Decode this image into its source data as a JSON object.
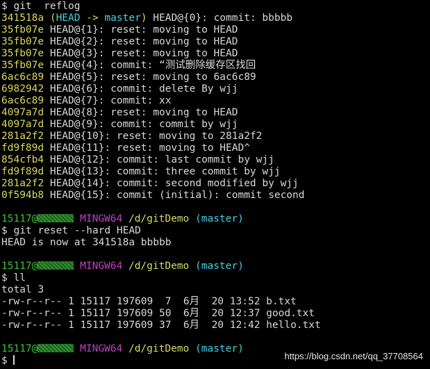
{
  "colors": {
    "background": "#000000",
    "text": "#d8d8d8",
    "hash": "#d8d860",
    "branch": "#48d0e0",
    "user": "#3cc33c",
    "mingw": "#c040c0",
    "path": "#d8d860"
  },
  "command1": "$ git  reflog",
  "reflog_first": {
    "hash": "341518a",
    "decoration_open": "(",
    "decoration_head": "HEAD",
    "decoration_arrow": " -> ",
    "decoration_branch": "master",
    "decoration_close": ")",
    "text": " HEAD@{0}: commit: bbbbb"
  },
  "reflog_entries": [
    {
      "hash": "35fb07e",
      "text": " HEAD@{1}: reset: moving to HEAD"
    },
    {
      "hash": "35fb07e",
      "text": " HEAD@{2}: reset: moving to HEAD"
    },
    {
      "hash": "35fb07e",
      "text": " HEAD@{3}: reset: moving to HEAD"
    },
    {
      "hash": "35fb07e",
      "text": " HEAD@{4}: commit: “测试删除缓存区找回"
    },
    {
      "hash": "6ac6c89",
      "text": " HEAD@{5}: reset: moving to 6ac6c89"
    },
    {
      "hash": "6982942",
      "text": " HEAD@{6}: commit: delete By wjj"
    },
    {
      "hash": "6ac6c89",
      "text": " HEAD@{7}: commit: xx"
    },
    {
      "hash": "4097a7d",
      "text": " HEAD@{8}: reset: moving to HEAD"
    },
    {
      "hash": "4097a7d",
      "text": " HEAD@{9}: commit: commit by wjj"
    },
    {
      "hash": "281a2f2",
      "text": " HEAD@{10}: reset: moving to 281a2f2"
    },
    {
      "hash": "fd9f89d",
      "text": " HEAD@{11}: reset: moving to HEAD^"
    },
    {
      "hash": "854cfb4",
      "text": " HEAD@{12}: commit: last commit by wjj"
    },
    {
      "hash": "fd9f89d",
      "text": " HEAD@{13}: commit: three commit by wjj"
    },
    {
      "hash": "281a2f2",
      "text": " HEAD@{14}: commit: second modified by wjj"
    },
    {
      "hash": "0f594b8",
      "text": " HEAD@{15}: commit (initial): commit second"
    }
  ],
  "prompt": {
    "user": "15117@",
    "mingw": "MINGW64",
    "path": "/d/gitDemo",
    "branch": "(master)"
  },
  "command2": "$ git reset --hard HEAD",
  "reset_output": "HEAD is now at 341518a bbbbb",
  "command3": "$ ll",
  "ll_total": "total 3",
  "ll_files": [
    "-rw-r--r-- 1 15117 197609  7  6月  20 13:52 b.txt",
    "-rw-r--r-- 1 15117 197609 50  6月  20 12:37 good.txt",
    "-rw-r--r-- 1 15117 197609 37  6月  20 12:42 hello.txt"
  ],
  "final_prompt_symbol": "$ ",
  "watermark": "https://blog.csdn.net/qq_37708564"
}
